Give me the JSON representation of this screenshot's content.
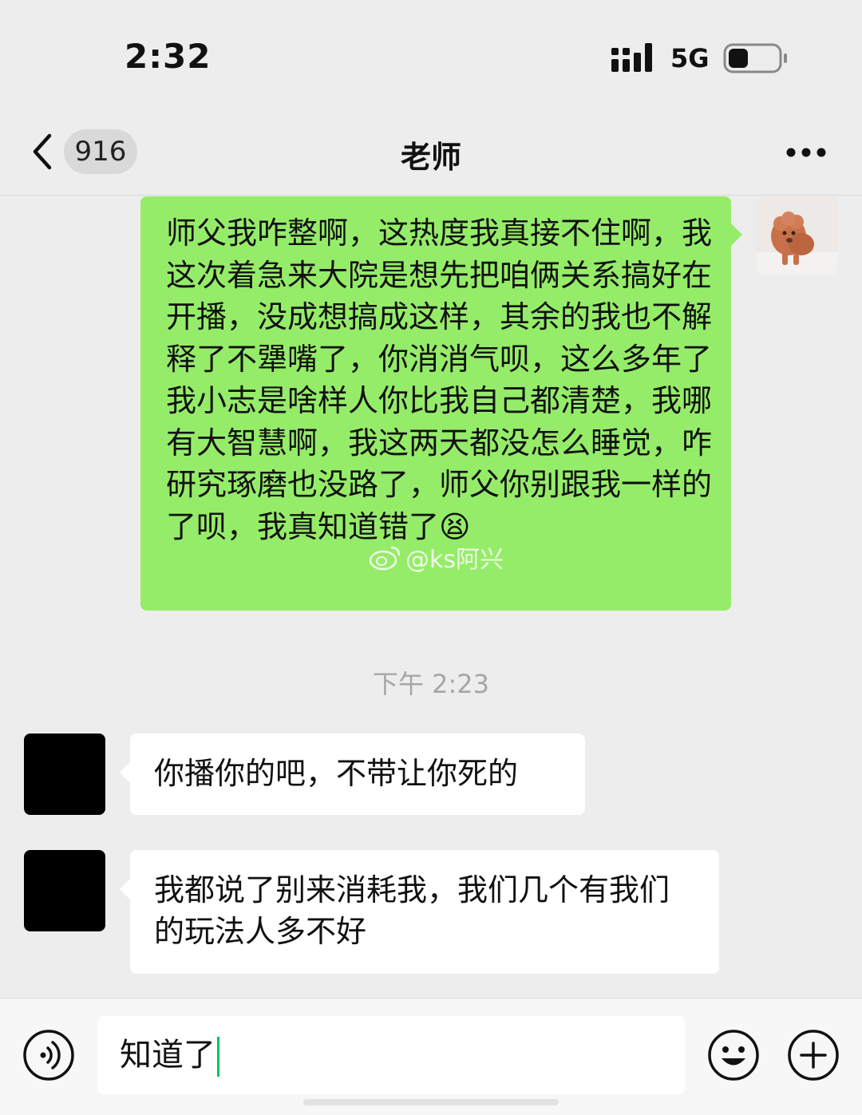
{
  "status_bar": {
    "time": "2:32",
    "network": "5G",
    "battery_level": 0.4
  },
  "nav": {
    "unread_count": "916",
    "title": "老师"
  },
  "messages": [
    {
      "side": "sent",
      "text": "师父我咋整啊，这热度我真接不住啊，我这次着急来大院是想先把咱俩关系搞好在开播，没成想搞成这样，其余的我也不解释了不犟嘴了，你消消气呗，这么多年了我小志是啥样人你比我自己都清楚，我哪有大智慧啊，我这两天都没怎么睡觉，咋研究琢磨也没路了，师父你别跟我一样的了呗，我真知道错了",
      "emoji": "😫"
    },
    {
      "side": "received",
      "text": "你播你的吧，不带让你死的"
    },
    {
      "side": "received",
      "text": "我都说了别来消耗我，我们几个有我们的玩法人多不好"
    }
  ],
  "timestamp": "下午 2:23",
  "watermark": "@ks阿兴",
  "input": {
    "value": "知道了"
  },
  "colors": {
    "sent_bubble": "#95ec69",
    "received_bubble": "#ffffff",
    "background": "#ededed",
    "caret": "#07c160"
  }
}
